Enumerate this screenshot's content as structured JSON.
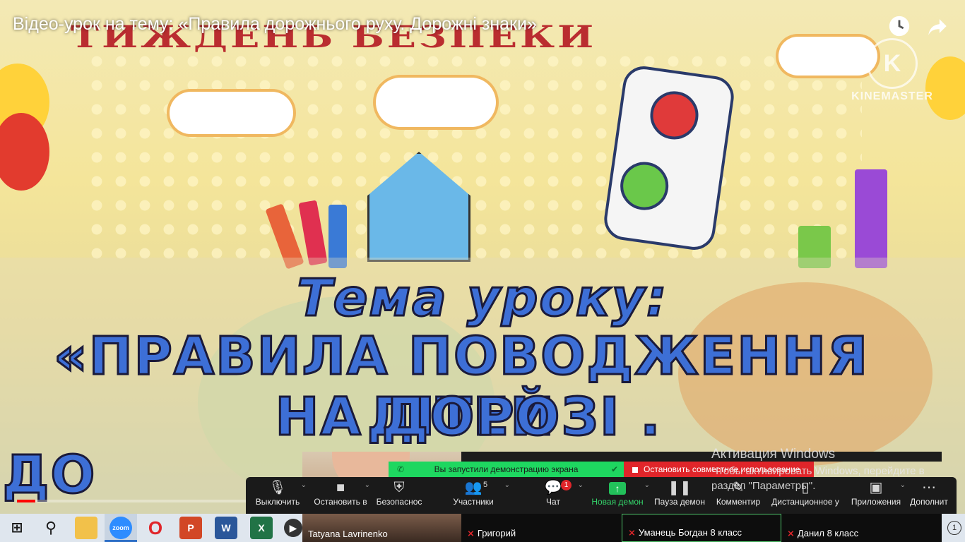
{
  "video": {
    "title": "Відео-урок на тему: «Правила дорожнього руху. Дорожні знаки»",
    "banner": "ТИЖДЕНЬ БЕЗПЕКИ",
    "watermark": "KINEMASTER",
    "watermark_logo": "K",
    "lesson": {
      "title": "Тема уроку:",
      "line1": "«ПРАВИЛА ПОВОДЖЕННЯ ДІТЕЙ",
      "line2": "НА ДОРОЗІ .",
      "line3": "ДО"
    },
    "progress": 0.02,
    "icons": [
      "clock-icon",
      "share-icon"
    ]
  },
  "activation": {
    "title": "Активация Windows",
    "subtitle": "Чтобы активировать Windows, перейдите в раздел \"Параметры\"."
  },
  "share_bar": {
    "status": "Вы запустили демонстрацию экрана",
    "stop": "Остановить совместное использование"
  },
  "toolbar": {
    "mute": "Выключить",
    "video": "Остановить в",
    "security": "Безопаснос",
    "participants": "Участники",
    "participants_count": "5",
    "chat": "Чат",
    "chat_badge": "1",
    "new_share": "Новая демон",
    "pause_share": "Пауза демон",
    "annotate": "Комментир",
    "remote": "Дистанционное у",
    "apps": "Приложения",
    "more": "Дополнит"
  },
  "participants": [
    {
      "name": "Tatyana Lavrinenko",
      "muted": false
    },
    {
      "name": "Григорий",
      "muted": true
    },
    {
      "name": "Уманець Богдан 8 класс",
      "muted": true
    },
    {
      "name": "Данил 8 класс",
      "muted": true
    }
  ],
  "taskbar": {
    "zoom_label": "zoom",
    "powerpoint": "P",
    "word": "W",
    "excel": "X",
    "opera": "O",
    "tray_badge": "1"
  },
  "colors": {
    "zoom_green": "#1ed760",
    "zoom_red": "#e0252a",
    "lesson_text": "#3d6fd6",
    "progress": "#ff0000"
  }
}
